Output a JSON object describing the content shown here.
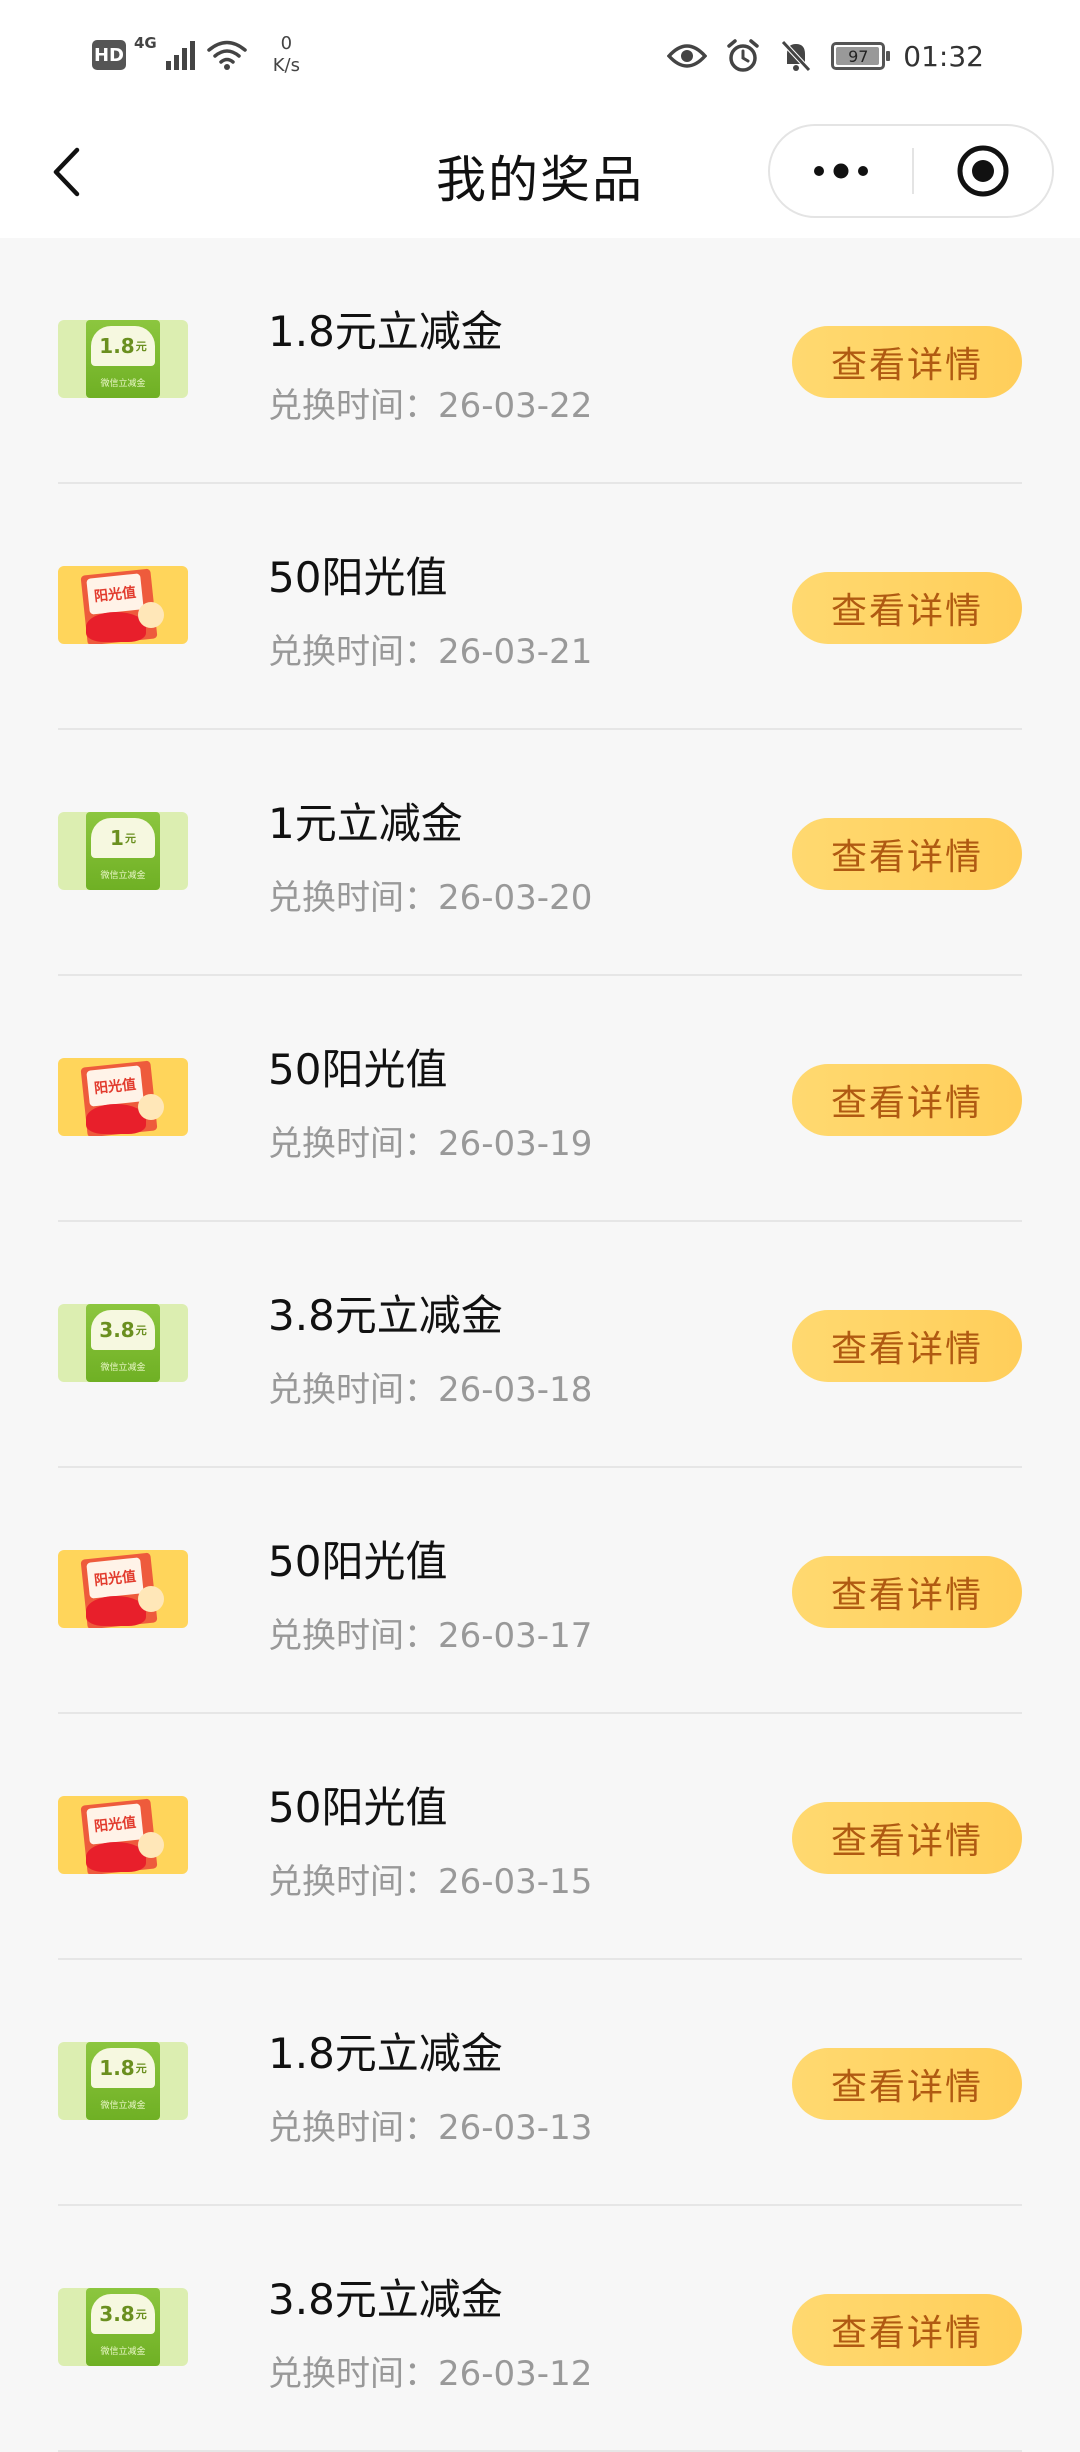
{
  "statusbar": {
    "hd": "HD",
    "network": "4G",
    "speed_value": "0",
    "speed_unit": "K/s",
    "battery": "97",
    "time": "01:32"
  },
  "navbar": {
    "title": "我的奖品"
  },
  "list": {
    "button_label": "查看详情",
    "items": [
      {
        "name": "1.8元立减金",
        "date": "兑换时间：26-03-22",
        "thumb_text": "1.8",
        "thumb_unit": "元",
        "thumb_sub": "微信立减金",
        "kind": "coupon"
      },
      {
        "name": "50阳光值",
        "date": "兑换时间：26-03-21",
        "thumb_text": "阳光值",
        "kind": "sunshine"
      },
      {
        "name": "1元立减金",
        "date": "兑换时间：26-03-20",
        "thumb_text": "1",
        "thumb_unit": "元",
        "thumb_sub": "微信立减金",
        "kind": "coupon"
      },
      {
        "name": "50阳光值",
        "date": "兑换时间：26-03-19",
        "thumb_text": "阳光值",
        "kind": "sunshine"
      },
      {
        "name": "3.8元立减金",
        "date": "兑换时间：26-03-18",
        "thumb_text": "3.8",
        "thumb_unit": "元",
        "thumb_sub": "微信立减金",
        "kind": "coupon"
      },
      {
        "name": "50阳光值",
        "date": "兑换时间：26-03-17",
        "thumb_text": "阳光值",
        "kind": "sunshine"
      },
      {
        "name": "50阳光值",
        "date": "兑换时间：26-03-15",
        "thumb_text": "阳光值",
        "kind": "sunshine"
      },
      {
        "name": "1.8元立减金",
        "date": "兑换时间：26-03-13",
        "thumb_text": "1.8",
        "thumb_unit": "元",
        "thumb_sub": "微信立减金",
        "kind": "coupon"
      },
      {
        "name": "3.8元立减金",
        "date": "兑换时间：26-03-12",
        "thumb_text": "3.8",
        "thumb_unit": "元",
        "thumb_sub": "微信立减金",
        "kind": "coupon"
      }
    ]
  }
}
